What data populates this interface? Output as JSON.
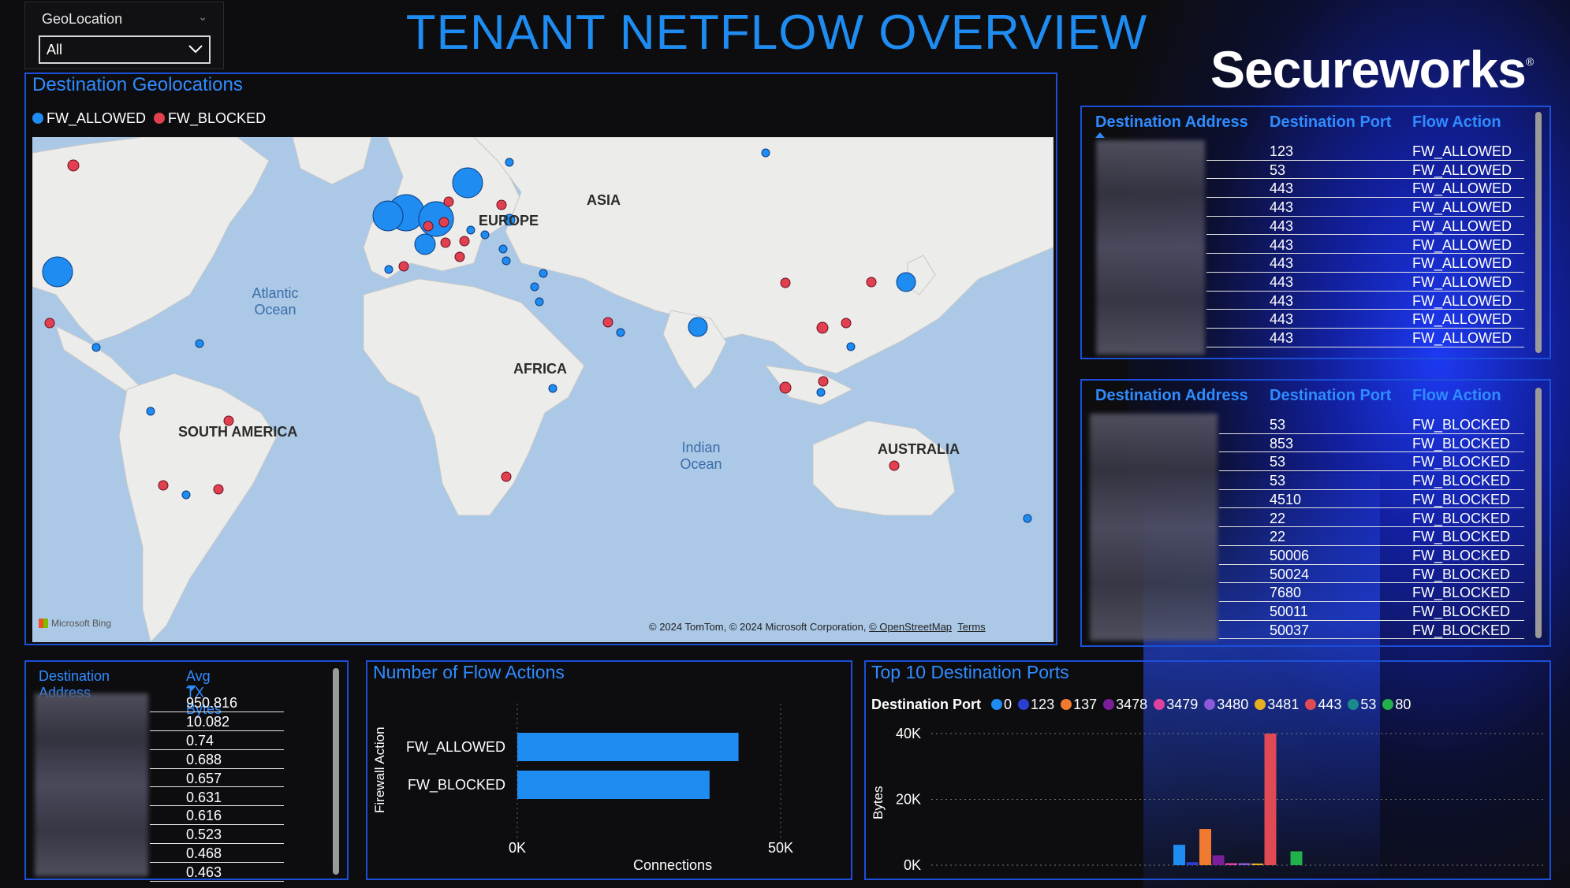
{
  "page": {
    "title": "TENANT NETFLOW OVERVIEW",
    "logo": "Secureworks",
    "logo_mark": "®"
  },
  "slicer": {
    "label": "GeoLocation",
    "value": "All"
  },
  "map_panel": {
    "title": "Destination Geolocations",
    "legend": [
      {
        "label": "FW_ALLOWED",
        "color": "#1e8cf0"
      },
      {
        "label": "FW_BLOCKED",
        "color": "#e04050"
      }
    ],
    "labels": {
      "europe": "EUROPE",
      "asia": "ASIA",
      "africa": "AFRICA",
      "south_america": "SOUTH AMERICA",
      "australia": "AUSTRALIA",
      "atlantic": "Atlantic",
      "atlantic2": "Ocean",
      "indian": "Indian",
      "indian2": "Ocean"
    },
    "attribution": "© 2024 TomTom, © 2024 Microsoft Corporation,",
    "osm": "© OpenStreetMap",
    "terms": "Terms",
    "bing": "Microsoft Bing"
  },
  "allowed_table": {
    "headers": [
      "Destination Address",
      "Destination Port",
      "Flow Action"
    ],
    "rows": [
      {
        "port": "123",
        "action": "FW_ALLOWED"
      },
      {
        "port": "53",
        "action": "FW_ALLOWED"
      },
      {
        "port": "443",
        "action": "FW_ALLOWED"
      },
      {
        "port": "443",
        "action": "FW_ALLOWED"
      },
      {
        "port": "443",
        "action": "FW_ALLOWED"
      },
      {
        "port": "443",
        "action": "FW_ALLOWED"
      },
      {
        "port": "443",
        "action": "FW_ALLOWED"
      },
      {
        "port": "443",
        "action": "FW_ALLOWED"
      },
      {
        "port": "443",
        "action": "FW_ALLOWED"
      },
      {
        "port": "443",
        "action": "FW_ALLOWED"
      },
      {
        "port": "443",
        "action": "FW_ALLOWED"
      }
    ]
  },
  "blocked_table": {
    "headers": [
      "Destination Address",
      "Destination Port",
      "Flow Action"
    ],
    "rows": [
      {
        "port": "53",
        "action": "FW_BLOCKED"
      },
      {
        "port": "853",
        "action": "FW_BLOCKED"
      },
      {
        "port": "53",
        "action": "FW_BLOCKED"
      },
      {
        "port": "53",
        "action": "FW_BLOCKED"
      },
      {
        "port": "4510",
        "action": "FW_BLOCKED"
      },
      {
        "port": "22",
        "action": "FW_BLOCKED"
      },
      {
        "port": "22",
        "action": "FW_BLOCKED"
      },
      {
        "port": "50006",
        "action": "FW_BLOCKED"
      },
      {
        "port": "50024",
        "action": "FW_BLOCKED"
      },
      {
        "port": "7680",
        "action": "FW_BLOCKED"
      },
      {
        "port": "50011",
        "action": "FW_BLOCKED"
      },
      {
        "port": "50037",
        "action": "FW_BLOCKED"
      }
    ]
  },
  "tx_table": {
    "headers": [
      "Destination Address",
      "Avg TX Bytes"
    ],
    "values": [
      "950.816",
      "10.082",
      "0.74",
      "0.688",
      "0.657",
      "0.631",
      "0.616",
      "0.523",
      "0.468",
      "0.463"
    ]
  },
  "flow_chart": {
    "title": "Number of Flow Actions",
    "ylabel": "Firewall Action",
    "xlabel": "Connections",
    "ticks": [
      "0K",
      "50K"
    ],
    "colors": {
      "bar": "#1e8cf0"
    }
  },
  "ports_chart": {
    "title": "Top 10 Destination Ports",
    "legend_title": "Destination Port",
    "ylabel": "Bytes",
    "ticks": [
      "40K",
      "20K",
      "0K"
    ]
  },
  "chart_data": [
    {
      "type": "bar",
      "orientation": "horizontal",
      "title": "Number of Flow Actions",
      "xlabel": "Connections",
      "ylabel": "Firewall Action",
      "categories": [
        "FW_ALLOWED",
        "FW_BLOCKED"
      ],
      "values": [
        42000,
        36500
      ],
      "xlim": [
        0,
        50000
      ],
      "grid": true
    },
    {
      "type": "bar",
      "title": "Top 10 Destination Ports",
      "ylabel": "Bytes",
      "ylim": [
        0,
        40000
      ],
      "legend_position": "top-left",
      "series": [
        {
          "name": "0",
          "color": "#1e8cf0",
          "values": [
            6200
          ]
        },
        {
          "name": "123",
          "color": "#2a3fd0",
          "values": [
            900
          ]
        },
        {
          "name": "137",
          "color": "#f07a30",
          "values": [
            11000
          ]
        },
        {
          "name": "3478",
          "color": "#7a1e9a",
          "values": [
            3000
          ]
        },
        {
          "name": "3479",
          "color": "#e040a0",
          "values": [
            600
          ]
        },
        {
          "name": "3480",
          "color": "#8a5ad8",
          "values": [
            600
          ]
        },
        {
          "name": "3481",
          "color": "#e8b020",
          "values": [
            500
          ]
        },
        {
          "name": "443",
          "color": "#e04a55",
          "values": [
            40000
          ]
        },
        {
          "name": "53",
          "color": "#1a8a8a",
          "values": [
            0
          ]
        },
        {
          "name": "80",
          "color": "#22b04a",
          "values": [
            4200
          ]
        }
      ]
    }
  ]
}
